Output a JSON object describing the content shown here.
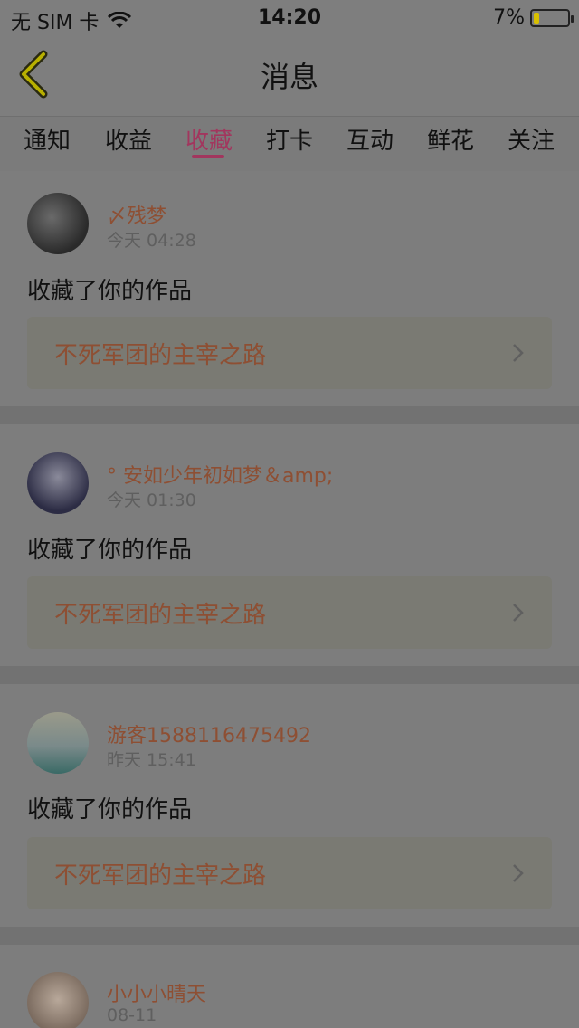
{
  "status": {
    "carrier": "无 SIM 卡",
    "time": "14:20",
    "battery": "7%"
  },
  "nav": {
    "title": "消息"
  },
  "tabs": [
    {
      "label": "通知"
    },
    {
      "label": "收益"
    },
    {
      "label": "收藏"
    },
    {
      "label": "打卡"
    },
    {
      "label": "互动"
    },
    {
      "label": "鲜花"
    },
    {
      "label": "关注"
    }
  ],
  "active_tab": "收藏",
  "messages": [
    {
      "user": "〆残梦",
      "time": "今天 04:28",
      "action": "收藏了你的作品",
      "work": "不死军团的主宰之路"
    },
    {
      "user": "° 安如少年初如梦＆amp;",
      "time": "今天 01:30",
      "action": "收藏了你的作品",
      "work": "不死军团的主宰之路"
    },
    {
      "user": "游客1588116475492",
      "time": "昨天 15:41",
      "action": "收藏了你的作品",
      "work": "不死军团的主宰之路"
    },
    {
      "user": "小小小晴天",
      "time": "08-11"
    }
  ],
  "colors": {
    "accent": "#a2365e",
    "username": "#8e4f33"
  }
}
